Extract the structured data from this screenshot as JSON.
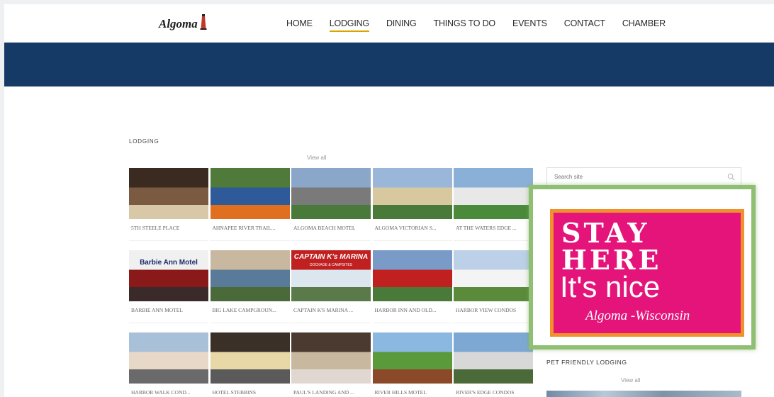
{
  "header": {
    "logo_text": "Algoma",
    "nav": [
      {
        "label": "HOME",
        "active": false
      },
      {
        "label": "LODGING",
        "active": true
      },
      {
        "label": "DINING",
        "active": false
      },
      {
        "label": "THINGS TO DO",
        "active": false
      },
      {
        "label": "EVENTS",
        "active": false
      },
      {
        "label": "CONTACT",
        "active": false
      },
      {
        "label": "CHAMBER",
        "active": false
      }
    ]
  },
  "colors": {
    "banner": "#163a66",
    "nav_active_underline": "#d9a400",
    "ad_background": "#e4147a",
    "ad_border": "#f0912b",
    "ad_frame": "#8fbf72"
  },
  "lodging": {
    "title": "LODGING",
    "view_all": "View all",
    "items": [
      {
        "name": "5TH STEELE PLACE"
      },
      {
        "name": "AHNAPEE RIVER TRAIL..."
      },
      {
        "name": "ALGOMA BEACH MOTEL"
      },
      {
        "name": "ALGOMA VICTORIAN S..."
      },
      {
        "name": "AT THE WATERS EDGE ..."
      },
      {
        "name": "BARBIE ANN MOTEL",
        "thumb_text": "Barbie Ann Motel"
      },
      {
        "name": "BIG LAKE CAMPGROUN..."
      },
      {
        "name": "CAPTAIN K'S MARINA ...",
        "thumb_text": "CAPTAIN K's MARINA",
        "thumb_subtext": "DOCKAGE & CAMPSITES"
      },
      {
        "name": "HARBOR INN AND OLD..."
      },
      {
        "name": "HARBOR VIEW CONDOS"
      },
      {
        "name": "HARBOR WALK COND..."
      },
      {
        "name": "HOTEL STEBBINS"
      },
      {
        "name": "PAUL'S LANDING AND ..."
      },
      {
        "name": "RIVER HILLS MOTEL"
      },
      {
        "name": "RIVER'S EDGE CONDOS"
      }
    ]
  },
  "sidebar": {
    "search_placeholder": "Search site",
    "search_icon": "search-icon",
    "ad": {
      "line1": "STAY",
      "line2": "HERE",
      "line3": "It's nice",
      "line4": "Algoma -Wisconsin"
    },
    "pet_title": "PET FRIENDLY LODGING",
    "pet_view_all": "View all"
  }
}
